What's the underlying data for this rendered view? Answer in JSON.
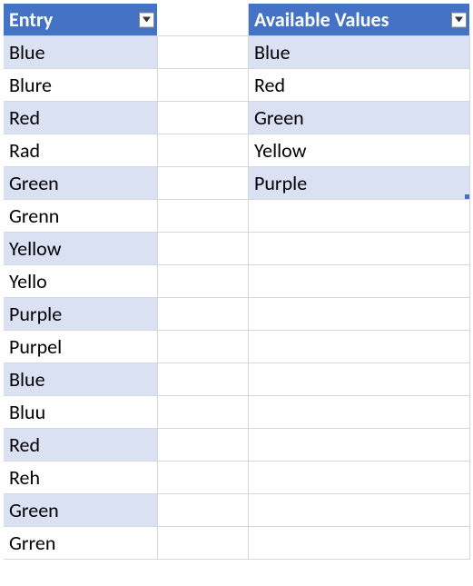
{
  "columns": {
    "entry": {
      "header": "Entry",
      "rows": [
        "Blue",
        "Blure",
        "Red",
        "Rad",
        "Green",
        "Grenn",
        "Yellow",
        "Yello",
        "Purple",
        "Purpel",
        "Blue",
        "Bluu",
        "Red",
        "Reh",
        "Green",
        "Grren"
      ]
    },
    "available": {
      "header": "Available Values",
      "rows": [
        "Blue",
        "Red",
        "Green",
        "Yellow",
        "Purple"
      ]
    }
  },
  "icons": {
    "filter_dropdown": "filter-dropdown"
  },
  "colors": {
    "header_bg": "#4472C4",
    "band_even": "#D9E1F2",
    "band_odd": "#FFFFFF"
  }
}
